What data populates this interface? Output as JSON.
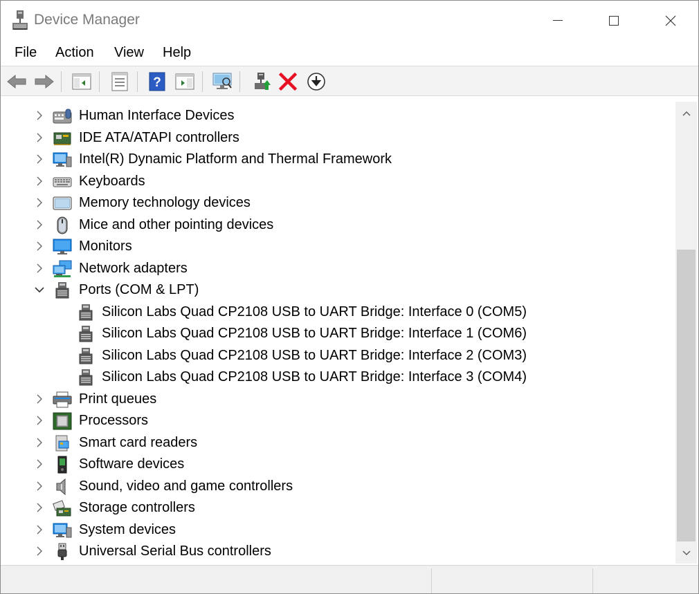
{
  "window": {
    "title": "Device Manager"
  },
  "menu": {
    "file": "File",
    "action": "Action",
    "view": "View",
    "help": "Help"
  },
  "toolbar_icons": [
    "back-icon",
    "forward-icon",
    "show-hide-console-tree-icon",
    "properties-icon",
    "help-icon",
    "action-pane-icon",
    "scan-hardware-icon",
    "update-driver-icon",
    "uninstall-icon",
    "disable-device-icon"
  ],
  "tree": {
    "categories": [
      {
        "label": "Human Interface Devices",
        "icon": "hid-icon"
      },
      {
        "label": "IDE ATA/ATAPI controllers",
        "icon": "ide-controller-icon"
      },
      {
        "label": "Intel(R) Dynamic Platform and Thermal Framework",
        "icon": "thermal-framework-icon"
      },
      {
        "label": "Keyboards",
        "icon": "keyboard-icon"
      },
      {
        "label": "Memory technology devices",
        "icon": "memory-device-icon"
      },
      {
        "label": "Mice and other pointing devices",
        "icon": "mouse-icon"
      },
      {
        "label": "Monitors",
        "icon": "monitor-icon"
      },
      {
        "label": "Network adapters",
        "icon": "network-adapter-icon"
      },
      {
        "label": "Ports (COM & LPT)",
        "icon": "port-icon",
        "expanded": true
      },
      {
        "label": "Print queues",
        "icon": "printer-icon"
      },
      {
        "label": "Processors",
        "icon": "processor-icon"
      },
      {
        "label": "Smart card readers",
        "icon": "smart-card-reader-icon"
      },
      {
        "label": "Software devices",
        "icon": "software-device-icon"
      },
      {
        "label": "Sound, video and game controllers",
        "icon": "speaker-icon"
      },
      {
        "label": "Storage controllers",
        "icon": "storage-controller-icon"
      },
      {
        "label": "System devices",
        "icon": "system-device-icon"
      },
      {
        "label": "Universal Serial Bus controllers",
        "icon": "usb-icon"
      }
    ],
    "ports_children": [
      "Silicon Labs Quad CP2108 USB to UART Bridge: Interface 0 (COM5)",
      "Silicon Labs Quad CP2108 USB to UART Bridge: Interface 1 (COM6)",
      "Silicon Labs Quad CP2108 USB to UART Bridge: Interface 2 (COM3)",
      "Silicon Labs Quad CP2108 USB to UART Bridge: Interface 3 (COM4)"
    ]
  },
  "colors": {
    "accent": "#0078d7",
    "scroll_thumb": "#cdcdcd",
    "uninstall_red": "#e81123"
  },
  "scroll": {
    "position_fraction": 0.32
  }
}
